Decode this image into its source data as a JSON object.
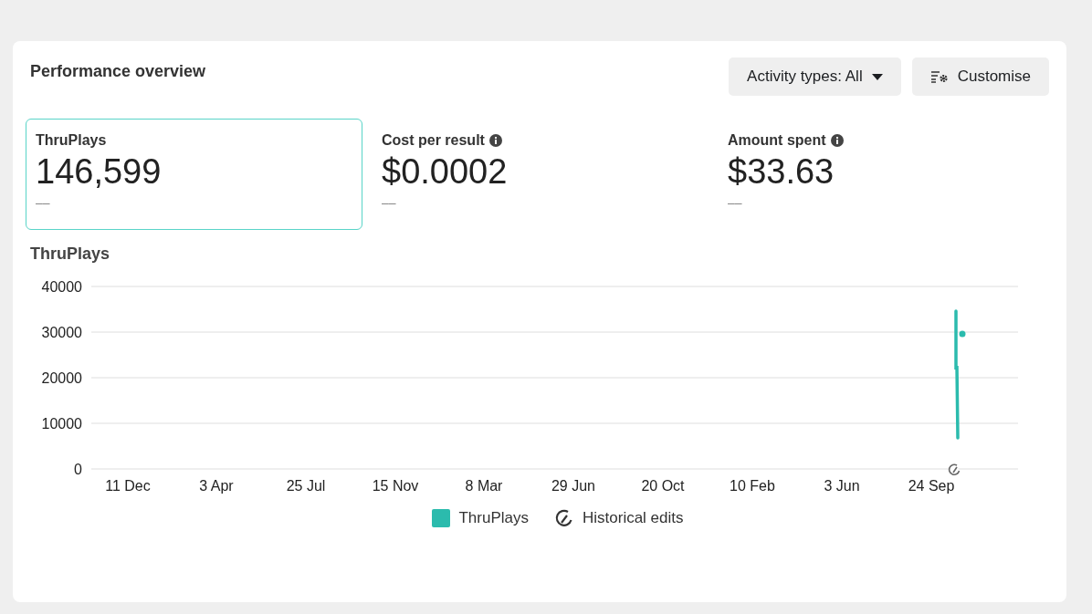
{
  "title": "Performance overview",
  "controls": [
    {
      "kind": "dropdown",
      "label": "Activity types: All"
    },
    {
      "kind": "customise",
      "label": "Customise"
    }
  ],
  "metrics": [
    {
      "label": "ThruPlays",
      "value": "146,599",
      "comparison": "––",
      "info": false,
      "selected": true
    },
    {
      "label": "Cost per result",
      "value": "$0.0002",
      "comparison": "––",
      "info": true,
      "selected": false
    },
    {
      "label": "Amount spent",
      "value": "$33.63",
      "comparison": "––",
      "info": true,
      "selected": false
    }
  ],
  "chart": {
    "title": "ThruPlays",
    "y_axis_labels": [
      "40000",
      "30000",
      "20000",
      "10000",
      "0"
    ],
    "x_axis_labels": [
      "11 Dec",
      "3 Apr",
      "25 Jul",
      "15 Nov",
      "8 Mar",
      "29 Jun",
      "20 Oct",
      "10 Feb",
      "3 Jun",
      "24 Sep"
    ],
    "legend": [
      {
        "kind": "series",
        "label": "ThruPlays",
        "color": "#2bbbad"
      },
      {
        "kind": "edits",
        "label": "Historical edits"
      }
    ]
  }
}
